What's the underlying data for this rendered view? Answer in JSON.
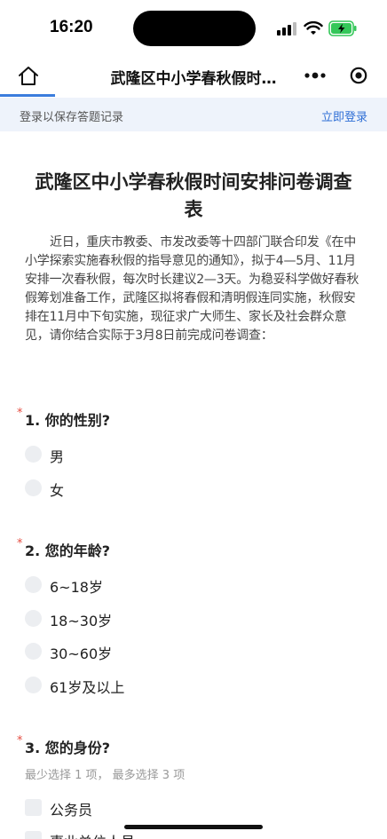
{
  "status_bar": {
    "time": "16:20"
  },
  "nav": {
    "title": "武隆区中小学春秋假时…"
  },
  "login_banner": {
    "text": "登录以保存答题记录",
    "link": "立即登录"
  },
  "survey": {
    "title": "武隆区中小学春秋假时间安排问卷调查表",
    "intro": "近日，重庆市教委、市发改委等十四部门联合印发《在中小学探索实施春秋假的指导意见的通知》，拟于4—5月、11月安排一次春秋假，每次时长建议2—3天。为稳妥科学做好春秋假筹划准备工作，武隆区拟将春假和清明假连同实施，秋假安排在11月中下旬实施，现征求广大师生、家长及社会群众意见，请你结合实际于3月8日前完成问卷调查："
  },
  "questions": [
    {
      "required_mark": "*",
      "title": "1. 你的性别?",
      "options": [
        "男",
        "女"
      ]
    },
    {
      "required_mark": "*",
      "title": "2. 您的年龄?",
      "options": [
        "6~18岁",
        "18~30岁",
        "30~60岁",
        "61岁及以上"
      ]
    },
    {
      "required_mark": "*",
      "title": "3. 您的身份?",
      "hint": "最少选择 1 项， 最多选择 3 项",
      "options": [
        "公务员",
        "事业单位人员"
      ]
    }
  ]
}
